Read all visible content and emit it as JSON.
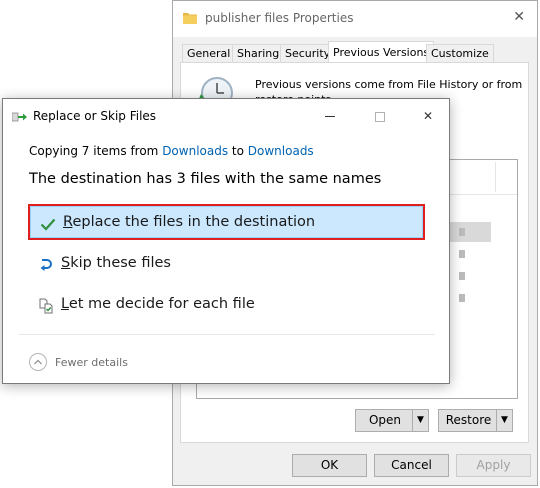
{
  "props_window": {
    "title": "publisher files Properties",
    "close_glyph": "✕",
    "tabs": [
      {
        "label": "General"
      },
      {
        "label": "Sharing"
      },
      {
        "label": "Security"
      },
      {
        "label": "Previous Versions",
        "active": true
      },
      {
        "label": "Customize"
      }
    ],
    "description": "Previous versions come from File History or from restore points.",
    "buttons": {
      "open": "Open",
      "restore": "Restore",
      "ok": "OK",
      "cancel": "Cancel",
      "apply": "Apply"
    },
    "dropdown_glyph": "▼"
  },
  "dialog": {
    "title": "Replace or Skip Files",
    "controls": {
      "close": "✕"
    },
    "copying": {
      "prefix": "Copying 7 items from ",
      "source": "Downloads",
      "middle": " to ",
      "destination": "Downloads"
    },
    "headline": "The destination has 3 files with the same names",
    "options": {
      "replace": {
        "accel": "R",
        "rest": "eplace the files in the destination",
        "icon": "checkmark-icon"
      },
      "skip": {
        "accel": "S",
        "rest": "kip these files",
        "icon": "skip-arrow-icon"
      },
      "decide": {
        "accel": "L",
        "rest": "et me decide for each file",
        "icon": "compare-files-icon"
      }
    },
    "fewer_details": "Fewer details"
  },
  "colors": {
    "link": "#0063b1",
    "selected_option_bg": "#cce8ff",
    "highlight_border": "#e0201f",
    "check_green": "#2f8f3c"
  }
}
